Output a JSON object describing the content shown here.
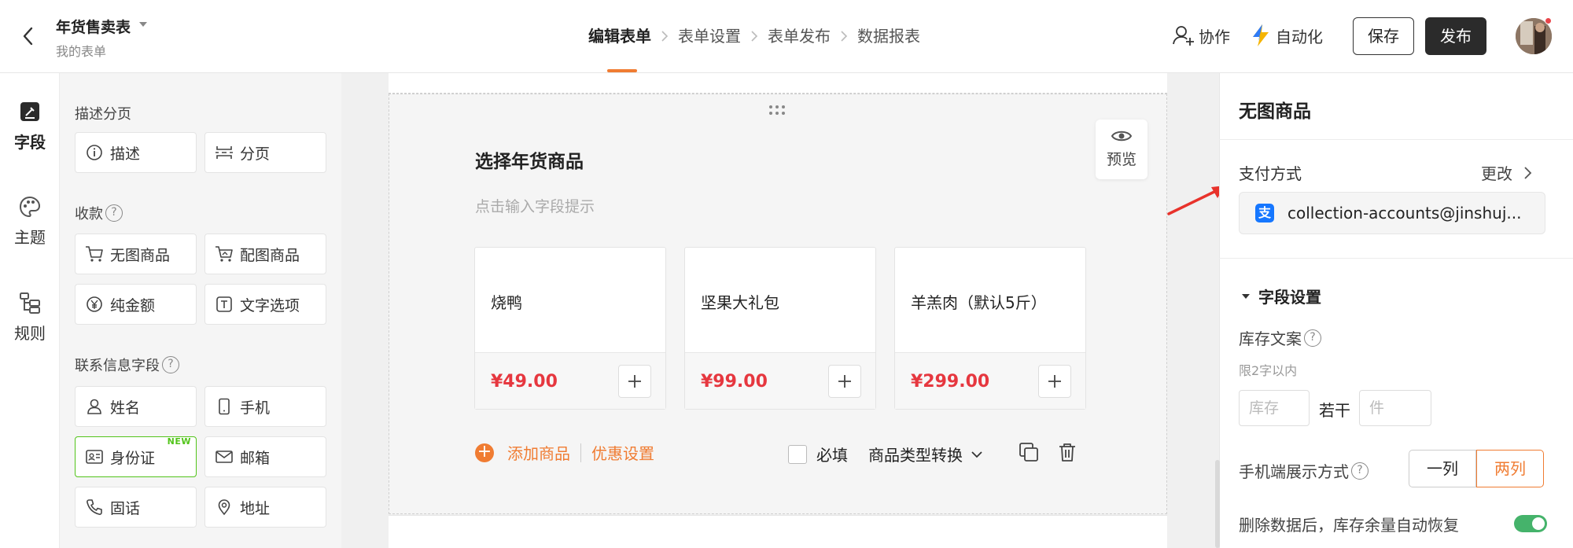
{
  "header": {
    "form_title": "年货售卖表",
    "form_subtitle": "我的表单",
    "steps": [
      "编辑表单",
      "表单设置",
      "表单发布",
      "数据报表"
    ],
    "collab_label": "协作",
    "automation_label": "自动化",
    "save_label": "保存",
    "publish_label": "发布",
    "accent_color": "#f07c32"
  },
  "rail": {
    "items": [
      {
        "label": "字段",
        "icon": "form-field-icon",
        "active": true
      },
      {
        "label": "主题",
        "icon": "palette-icon",
        "active": false
      },
      {
        "label": "规则",
        "icon": "rules-icon",
        "active": false
      }
    ]
  },
  "components": {
    "groups": [
      {
        "title": "描述分页",
        "items": [
          {
            "label": "描述",
            "icon": "info-icon"
          },
          {
            "label": "分页",
            "icon": "page-break-icon"
          }
        ]
      },
      {
        "title": "收款",
        "help": "?",
        "items": [
          {
            "label": "无图商品",
            "icon": "cart-icon"
          },
          {
            "label": "配图商品",
            "icon": "cart-image-icon"
          },
          {
            "label": "纯金额",
            "icon": "yen-icon"
          },
          {
            "label": "文字选项",
            "icon": "text-option-icon"
          }
        ]
      },
      {
        "title": "联系信息字段",
        "help": "?",
        "items": [
          {
            "label": "姓名",
            "icon": "user-icon"
          },
          {
            "label": "手机",
            "icon": "phone-icon"
          },
          {
            "label": "身份证",
            "icon": "id-card-icon",
            "badge": "NEW"
          },
          {
            "label": "邮箱",
            "icon": "mail-icon"
          },
          {
            "label": "固话",
            "icon": "telephone-icon"
          },
          {
            "label": "地址",
            "icon": "location-icon"
          }
        ]
      }
    ]
  },
  "canvas": {
    "field_title": "选择年货商品",
    "field_hint": "点击输入字段提示",
    "preview_label": "预览",
    "products": [
      {
        "name": "烧鸭",
        "price": "¥49.00"
      },
      {
        "name": "坚果大礼包",
        "price": "¥99.00"
      },
      {
        "name": "羊羔肉（默认5斤）",
        "price": "¥299.00"
      }
    ],
    "add_product_label": "添加商品",
    "discount_label": "优惠设置",
    "required_label": "必填",
    "type_switch_label": "商品类型转换"
  },
  "settings": {
    "title": "无图商品",
    "payment_label": "支付方式",
    "payment_change": "更改",
    "payment_account": "collection-accounts@jinshuj...",
    "section_title": "字段设置",
    "stock_label": "库存文案",
    "stock_sub": "限2字以内",
    "stock_placeholder": "库存",
    "stock_middle": "若干",
    "unit_placeholder": "件",
    "mobile_label": "手机端展示方式",
    "mobile_options": [
      "一列",
      "两列"
    ],
    "mobile_selected": "两列",
    "restore_label": "删除数据后，库存余量自动恢复",
    "restore_enabled": true
  }
}
